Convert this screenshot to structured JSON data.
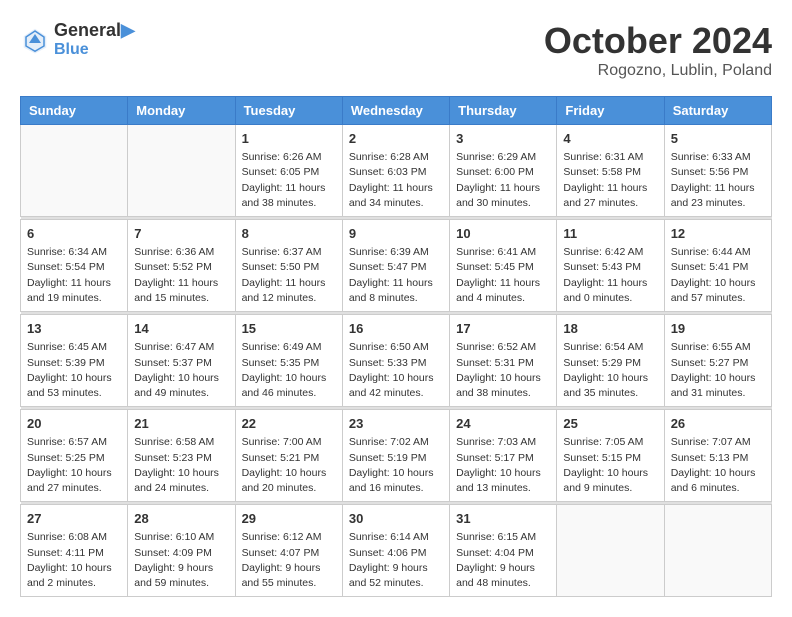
{
  "header": {
    "logo_line1": "General",
    "logo_line2": "Blue",
    "month": "October 2024",
    "location": "Rogozno, Lublin, Poland"
  },
  "weekdays": [
    "Sunday",
    "Monday",
    "Tuesday",
    "Wednesday",
    "Thursday",
    "Friday",
    "Saturday"
  ],
  "weeks": [
    [
      {
        "day": "",
        "sunrise": "",
        "sunset": "",
        "daylight": ""
      },
      {
        "day": "",
        "sunrise": "",
        "sunset": "",
        "daylight": ""
      },
      {
        "day": "1",
        "sunrise": "Sunrise: 6:26 AM",
        "sunset": "Sunset: 6:05 PM",
        "daylight": "Daylight: 11 hours and 38 minutes."
      },
      {
        "day": "2",
        "sunrise": "Sunrise: 6:28 AM",
        "sunset": "Sunset: 6:03 PM",
        "daylight": "Daylight: 11 hours and 34 minutes."
      },
      {
        "day": "3",
        "sunrise": "Sunrise: 6:29 AM",
        "sunset": "Sunset: 6:00 PM",
        "daylight": "Daylight: 11 hours and 30 minutes."
      },
      {
        "day": "4",
        "sunrise": "Sunrise: 6:31 AM",
        "sunset": "Sunset: 5:58 PM",
        "daylight": "Daylight: 11 hours and 27 minutes."
      },
      {
        "day": "5",
        "sunrise": "Sunrise: 6:33 AM",
        "sunset": "Sunset: 5:56 PM",
        "daylight": "Daylight: 11 hours and 23 minutes."
      }
    ],
    [
      {
        "day": "6",
        "sunrise": "Sunrise: 6:34 AM",
        "sunset": "Sunset: 5:54 PM",
        "daylight": "Daylight: 11 hours and 19 minutes."
      },
      {
        "day": "7",
        "sunrise": "Sunrise: 6:36 AM",
        "sunset": "Sunset: 5:52 PM",
        "daylight": "Daylight: 11 hours and 15 minutes."
      },
      {
        "day": "8",
        "sunrise": "Sunrise: 6:37 AM",
        "sunset": "Sunset: 5:50 PM",
        "daylight": "Daylight: 11 hours and 12 minutes."
      },
      {
        "day": "9",
        "sunrise": "Sunrise: 6:39 AM",
        "sunset": "Sunset: 5:47 PM",
        "daylight": "Daylight: 11 hours and 8 minutes."
      },
      {
        "day": "10",
        "sunrise": "Sunrise: 6:41 AM",
        "sunset": "Sunset: 5:45 PM",
        "daylight": "Daylight: 11 hours and 4 minutes."
      },
      {
        "day": "11",
        "sunrise": "Sunrise: 6:42 AM",
        "sunset": "Sunset: 5:43 PM",
        "daylight": "Daylight: 11 hours and 0 minutes."
      },
      {
        "day": "12",
        "sunrise": "Sunrise: 6:44 AM",
        "sunset": "Sunset: 5:41 PM",
        "daylight": "Daylight: 10 hours and 57 minutes."
      }
    ],
    [
      {
        "day": "13",
        "sunrise": "Sunrise: 6:45 AM",
        "sunset": "Sunset: 5:39 PM",
        "daylight": "Daylight: 10 hours and 53 minutes."
      },
      {
        "day": "14",
        "sunrise": "Sunrise: 6:47 AM",
        "sunset": "Sunset: 5:37 PM",
        "daylight": "Daylight: 10 hours and 49 minutes."
      },
      {
        "day": "15",
        "sunrise": "Sunrise: 6:49 AM",
        "sunset": "Sunset: 5:35 PM",
        "daylight": "Daylight: 10 hours and 46 minutes."
      },
      {
        "day": "16",
        "sunrise": "Sunrise: 6:50 AM",
        "sunset": "Sunset: 5:33 PM",
        "daylight": "Daylight: 10 hours and 42 minutes."
      },
      {
        "day": "17",
        "sunrise": "Sunrise: 6:52 AM",
        "sunset": "Sunset: 5:31 PM",
        "daylight": "Daylight: 10 hours and 38 minutes."
      },
      {
        "day": "18",
        "sunrise": "Sunrise: 6:54 AM",
        "sunset": "Sunset: 5:29 PM",
        "daylight": "Daylight: 10 hours and 35 minutes."
      },
      {
        "day": "19",
        "sunrise": "Sunrise: 6:55 AM",
        "sunset": "Sunset: 5:27 PM",
        "daylight": "Daylight: 10 hours and 31 minutes."
      }
    ],
    [
      {
        "day": "20",
        "sunrise": "Sunrise: 6:57 AM",
        "sunset": "Sunset: 5:25 PM",
        "daylight": "Daylight: 10 hours and 27 minutes."
      },
      {
        "day": "21",
        "sunrise": "Sunrise: 6:58 AM",
        "sunset": "Sunset: 5:23 PM",
        "daylight": "Daylight: 10 hours and 24 minutes."
      },
      {
        "day": "22",
        "sunrise": "Sunrise: 7:00 AM",
        "sunset": "Sunset: 5:21 PM",
        "daylight": "Daylight: 10 hours and 20 minutes."
      },
      {
        "day": "23",
        "sunrise": "Sunrise: 7:02 AM",
        "sunset": "Sunset: 5:19 PM",
        "daylight": "Daylight: 10 hours and 16 minutes."
      },
      {
        "day": "24",
        "sunrise": "Sunrise: 7:03 AM",
        "sunset": "Sunset: 5:17 PM",
        "daylight": "Daylight: 10 hours and 13 minutes."
      },
      {
        "day": "25",
        "sunrise": "Sunrise: 7:05 AM",
        "sunset": "Sunset: 5:15 PM",
        "daylight": "Daylight: 10 hours and 9 minutes."
      },
      {
        "day": "26",
        "sunrise": "Sunrise: 7:07 AM",
        "sunset": "Sunset: 5:13 PM",
        "daylight": "Daylight: 10 hours and 6 minutes."
      }
    ],
    [
      {
        "day": "27",
        "sunrise": "Sunrise: 6:08 AM",
        "sunset": "Sunset: 4:11 PM",
        "daylight": "Daylight: 10 hours and 2 minutes."
      },
      {
        "day": "28",
        "sunrise": "Sunrise: 6:10 AM",
        "sunset": "Sunset: 4:09 PM",
        "daylight": "Daylight: 9 hours and 59 minutes."
      },
      {
        "day": "29",
        "sunrise": "Sunrise: 6:12 AM",
        "sunset": "Sunset: 4:07 PM",
        "daylight": "Daylight: 9 hours and 55 minutes."
      },
      {
        "day": "30",
        "sunrise": "Sunrise: 6:14 AM",
        "sunset": "Sunset: 4:06 PM",
        "daylight": "Daylight: 9 hours and 52 minutes."
      },
      {
        "day": "31",
        "sunrise": "Sunrise: 6:15 AM",
        "sunset": "Sunset: 4:04 PM",
        "daylight": "Daylight: 9 hours and 48 minutes."
      },
      {
        "day": "",
        "sunrise": "",
        "sunset": "",
        "daylight": ""
      },
      {
        "day": "",
        "sunrise": "",
        "sunset": "",
        "daylight": ""
      }
    ]
  ]
}
